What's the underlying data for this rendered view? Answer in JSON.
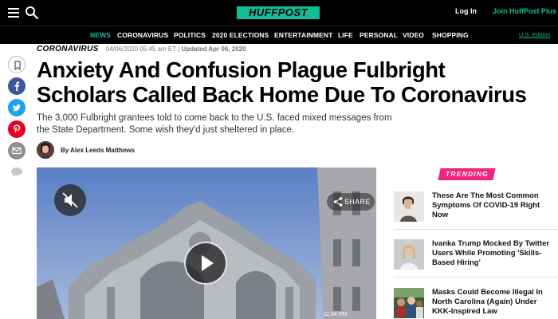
{
  "header": {
    "logo": "HUFFPOST",
    "login": "Log In",
    "join": "Join HuffPost Plus",
    "menu_icon": "hamburger-menu-icon",
    "search_icon": "search-icon"
  },
  "nav": {
    "items": [
      "NEWS",
      "CORONAVIRUS",
      "POLITICS",
      "2020 ELECTIONS",
      "ENTERTAINMENT",
      "LIFE",
      "PERSONAL",
      "VIDEO",
      "SHOPPING"
    ],
    "active": "NEWS",
    "edition": "U.S. Edition"
  },
  "share_rail": {
    "icons": [
      "bookmark-icon",
      "facebook-icon",
      "twitter-icon",
      "pinterest-icon",
      "email-icon",
      "comments-icon"
    ]
  },
  "article": {
    "section": "CORONAVIRUS",
    "published": "04/06/2020 05:45 am ET",
    "updated": "Updated Apr 06, 2020",
    "headline": "Anxiety And Confusion Plague Fulbright Scholars Called Back Home Due To Coronavirus",
    "dek": "The 3,000 Fulbright grantees told to come back to the U.S. faced mixed messages from the State Department. Some wish they'd just sheltered in place.",
    "author": "By Alex Leeds Matthews"
  },
  "video": {
    "share_label": "SHARE",
    "timestamp": "11:04 PM"
  },
  "trending": {
    "label": "TRENDING",
    "items": [
      {
        "title": "These Are The Most Common Symptoms Of COVID-19 Right Now"
      },
      {
        "title": "Ivanka Trump Mocked By Twitter Users While Promoting 'Skills-Based Hiring'"
      },
      {
        "title": "Masks Could Become Illegal In North Carolina (Again) Under KKK-Inspired Law"
      }
    ]
  },
  "colors": {
    "brand_green": "#0dbe98",
    "trending_pink": "#f0237d",
    "facebook": "#3b5998",
    "twitter": "#1da1f2",
    "pinterest": "#e60023"
  }
}
